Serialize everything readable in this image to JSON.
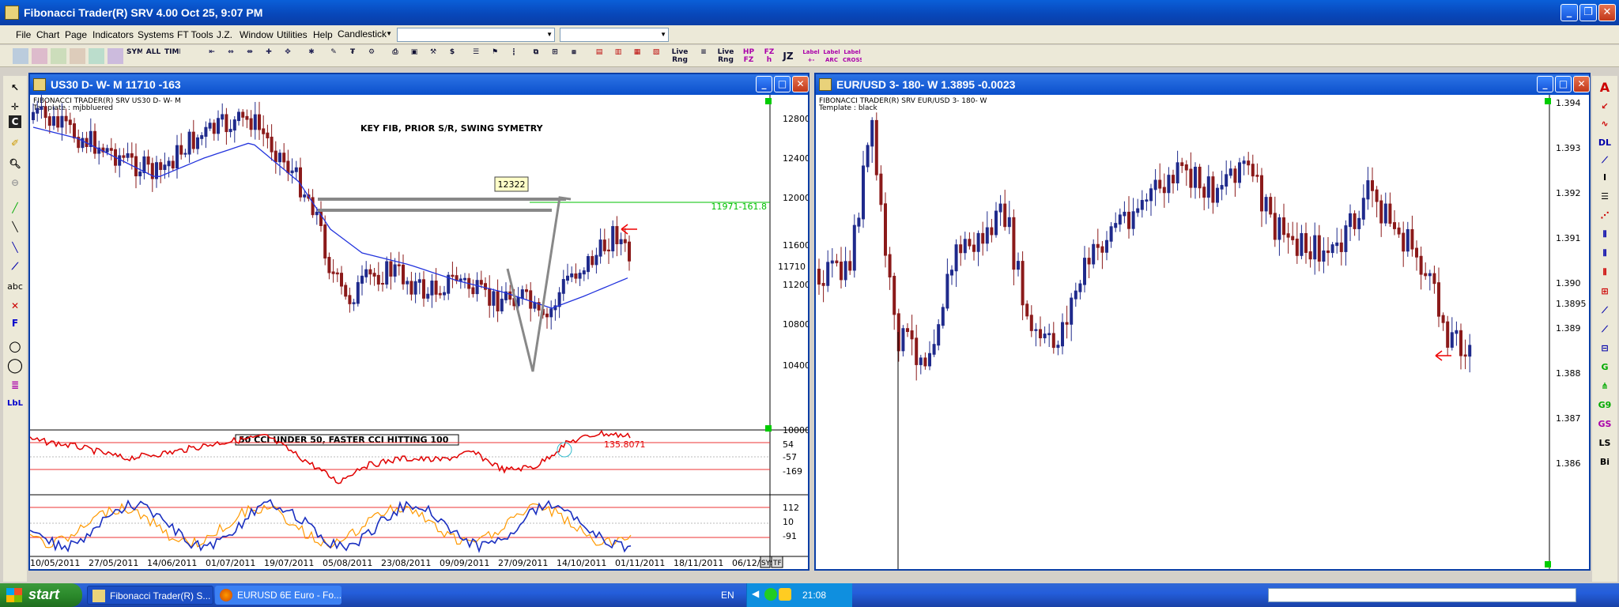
{
  "app": {
    "title": "Fibonacci Trader(R) SRV 4.00 Oct 25,  9:07 PM"
  },
  "menu": [
    "File",
    "Chart",
    "Page",
    "Indicators",
    "Systems",
    "FT Tools",
    "J.Z.",
    "Window",
    "Utilities",
    "Help"
  ],
  "chart_style_select": "Candlestick",
  "toolbar_labels": [
    "Live Rng",
    "Live Rng",
    "HP FZ",
    "FZ h",
    "JZ",
    "Label +-",
    "Label ARC",
    "Label CROSS"
  ],
  "left_tools": [
    "pointer-icon",
    "crosshair-icon",
    "c-icon",
    "highlighter-icon",
    "zoom-icon",
    "zoom-out-icon",
    "trendline-green-icon",
    "trendline-black-icon",
    "trendline-blue-icon",
    "ray-icon",
    "text-icon",
    "delete-icon",
    "fib-icon",
    "circle-icon",
    "ellipse-icon",
    "lines-icon",
    "label-icon"
  ],
  "left_tool_text": {
    "abc": "abc",
    "F": "F",
    "LbL": "LbL"
  },
  "right_tools_text": {
    "A": "A",
    "DL": "DL",
    "I": "I",
    "G9": "G9",
    "GS": "GS",
    "LS": "LS",
    "Bi": "Bi"
  },
  "window_left": {
    "title": "US30 D- W- M  11710  -163",
    "header_line1": "FIBONACCI TRADER(R) SRV    US30 D- W- M",
    "header_line2": "Template : mjbbluered",
    "annotation": "KEY FIB, PRIOR S/R, SWING SYMETRY",
    "target_box": "12322",
    "fib_label": "11971-161.8",
    "cci_note": "50 CCI UNDER 50, FASTER CCI HITTING 100",
    "cci_value": "135.8071",
    "price_axis": [
      "12800",
      "12400",
      "12000",
      "11710",
      "11600",
      "11200",
      "10800",
      "10400",
      "10000"
    ],
    "cci_axis": [
      "54",
      "-57",
      "-169"
    ],
    "osc_axis": [
      "112",
      "10",
      "-91"
    ],
    "date_axis": [
      "10/05/2011",
      "27/05/2011",
      "14/06/2011",
      "01/07/2011",
      "19/07/2011",
      "05/08/2011",
      "23/08/2011",
      "09/09/2011",
      "27/09/2011",
      "14/10/2011",
      "01/11/2011",
      "18/11/2011",
      "06/12/2011"
    ],
    "corner_tags": [
      "SYS",
      "TF"
    ],
    "current_price": "11710"
  },
  "window_right": {
    "title": "EUR/USD 3- 180- W  1.3895  -0.0023",
    "header_line1": "FIBONACCI TRADER(R) SRV    EUR/USD 3- 180- W",
    "header_line2": "Template : black",
    "price_axis": [
      "1.394",
      "1.393",
      "1.392",
      "1.391",
      "1.390",
      "1.3895",
      "1.389",
      "1.388",
      "1.387",
      "1.386"
    ],
    "current_price": "1.3895"
  },
  "taskbar": {
    "start": "start",
    "tasks": [
      "Fibonacci Trader(R) S...",
      "EURUSD 6E Euro - Fo..."
    ],
    "lang": "EN",
    "clock": "21:08"
  },
  "colors": {
    "xp_blue": "#0a4fcb",
    "bull": "#1f2a8c",
    "bear": "#8b1a1a",
    "cci": "#e00000",
    "fib": "#00c000"
  }
}
